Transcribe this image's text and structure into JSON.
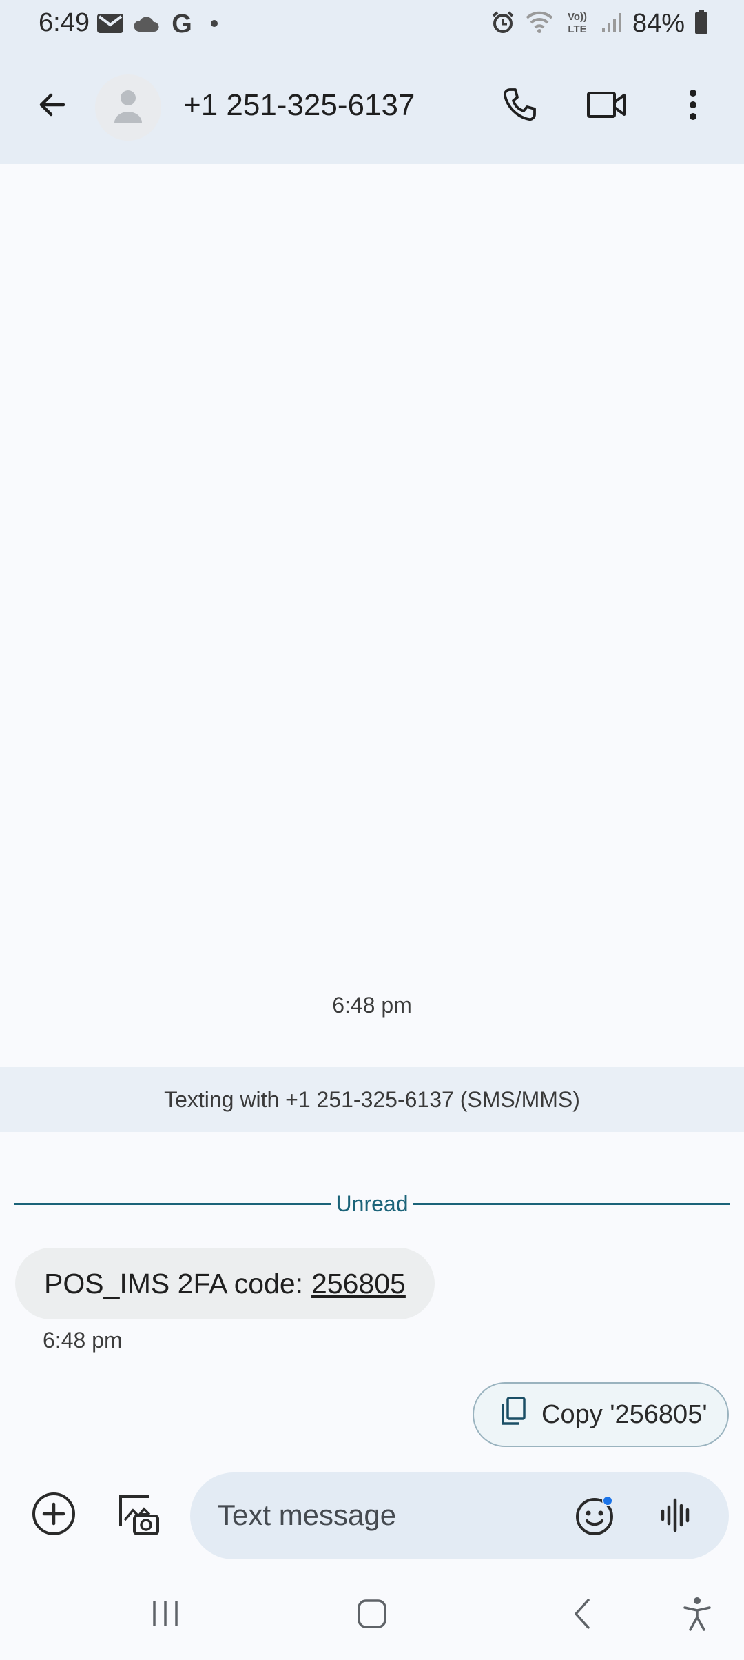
{
  "status_bar": {
    "time": "6:49",
    "notification_icons": [
      "gmail-icon",
      "onedrive-icon",
      "google-icon"
    ],
    "system_icons": [
      "alarm-icon",
      "wifi-icon",
      "volte-lte-icon",
      "signal-icon",
      "battery-icon"
    ],
    "volte_label": "Vo))",
    "lte_label": "LTE",
    "google_letter": "G",
    "battery_percent": "84%"
  },
  "app_bar": {
    "contact_title": "+1 251-325-6137",
    "icons": [
      "back-arrow-icon",
      "person-icon",
      "phone-icon",
      "video-camera-icon",
      "more-vert-icon"
    ]
  },
  "conversation": {
    "timestamp_header": "6:48 pm",
    "sms_banner": "Texting with +1 251-325-6137 (SMS/MMS)",
    "unread_label": "Unread",
    "messages": [
      {
        "text_prefix": "POS_IMS 2FA code:",
        "code": "256805",
        "time": "6:48 pm"
      }
    ],
    "suggestion_chip": {
      "label": "Copy '256805'",
      "icon": "copy-icon"
    }
  },
  "compose": {
    "placeholder": "Text message",
    "icons": [
      "add-circle-icon",
      "gallery-icon",
      "emoji-icon",
      "voice-waveform-icon"
    ]
  },
  "nav_bar": {
    "icons": [
      "recent-apps-icon",
      "home-icon",
      "back-icon",
      "accessibility-icon"
    ]
  },
  "colors": {
    "app_bar_bg": "#e6edf5",
    "screen_bg": "#f9fafd",
    "banner_bg": "#e9eff6",
    "unread_accent": "#1b6379",
    "bubble_bg": "#eceeef",
    "compose_bg": "#e3ebf4",
    "emoji_badge": "#1a73e8"
  }
}
